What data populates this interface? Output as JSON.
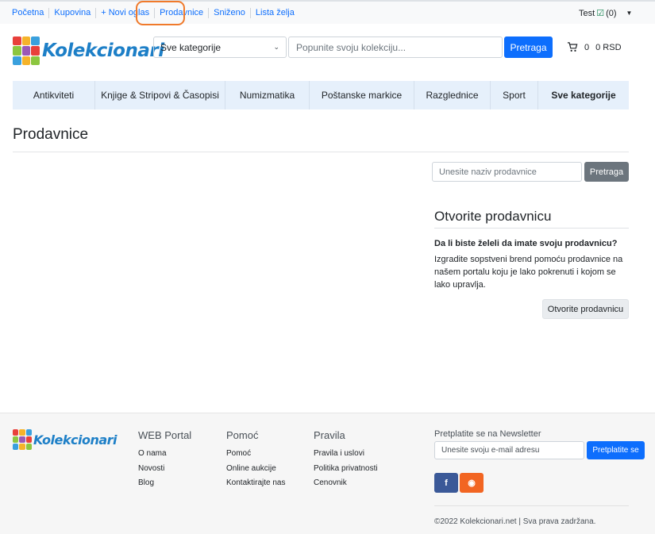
{
  "topbar": {
    "links": [
      "Početna",
      "Kupovina",
      "+ Novi oglas",
      "Prodavnice",
      "Sniženo",
      "Lista želja"
    ],
    "user_name": "Test",
    "user_count": "(0)"
  },
  "header": {
    "logo_text": "Kolekcionari",
    "category_select": "Sve kategorije",
    "search_placeholder": "Popunite svoju kolekciju...",
    "search_button": "Pretraga",
    "cart_count": "0",
    "cart_total": "0 RSD"
  },
  "nav": {
    "items": [
      "Antikviteti",
      "Knjige & Stripovi & Časopisi",
      "Numizmatika",
      "Poštanske markice",
      "Razglednice",
      "Sport",
      "Sve kategorije"
    ]
  },
  "main": {
    "title": "Prodavnice",
    "store_search_placeholder": "Unesite naziv prodavnice",
    "store_search_button": "Pretraga",
    "open_store": {
      "title": "Otvorite prodavnicu",
      "question": "Da li biste želeli da imate svoju prodavnicu?",
      "text": "Izgradite sopstveni brend pomoću prodavnice na našem portalu koju je lako pokrenuti i kojom se lako upravlja.",
      "button": "Otvorite prodavnicu"
    }
  },
  "footer": {
    "columns": [
      {
        "heading": "WEB Portal",
        "links": [
          "O nama",
          "Novosti",
          "Blog"
        ]
      },
      {
        "heading": "Pomoć",
        "links": [
          "Pomoć",
          "Online aukcije",
          "Kontaktirajte nas"
        ]
      },
      {
        "heading": "Pravila",
        "links": [
          "Pravila i uslovi",
          "Politika privatnosti",
          "Cenovnik"
        ]
      }
    ],
    "newsletter_heading": "Pretplatite se na Newsletter",
    "newsletter_placeholder": "Unesite svoju e-mail adresu",
    "newsletter_button": "Pretplatite se",
    "social": {
      "facebook_glyph": "f",
      "rss_glyph": "◉",
      "facebook_color": "#3b5998",
      "rss_color": "#f26522"
    },
    "copyright": "©2022 Kolekcionari.net | Sva prava zadržana."
  },
  "colors": {
    "primary": "#0d6efd",
    "secondary": "#6c757d",
    "nav_bg": "#e6f0fb",
    "highlight": "#f07a2b",
    "logo": "#1d7fc7"
  }
}
